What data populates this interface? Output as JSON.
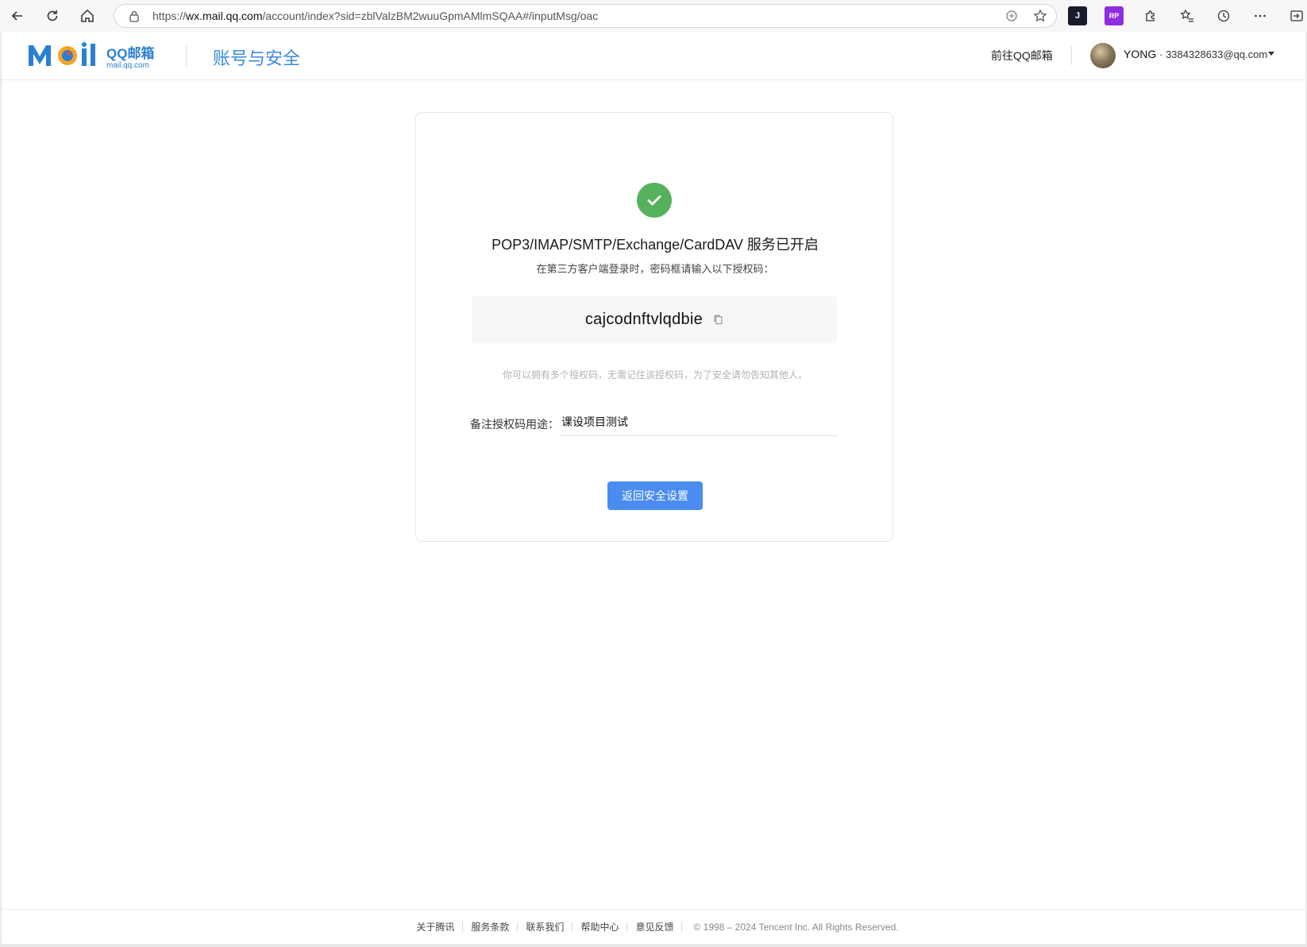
{
  "browser": {
    "url_prefix": "https://",
    "url_host": "wx.mail.qq.com",
    "url_path": "/account/index?sid=zblValzBM2wuuGpmAMlmSQAA#/inputMsg/oac",
    "extensions": [
      "J",
      "RP"
    ]
  },
  "header": {
    "logo_mark": "Mail",
    "logo_cn": "QQ邮箱",
    "logo_domain": "mail.qq.com",
    "title": "账号与安全",
    "goto_mail": "前往QQ邮箱",
    "user_name": "YONG",
    "user_email": "· 3384328633@qq.com"
  },
  "card": {
    "title": "POP3/IMAP/SMTP/Exchange/CardDAV 服务已开启",
    "subtitle": "在第三方客户端登录时，密码框请输入以下授权码：",
    "auth_code": "cajcodnftvlqdbie",
    "hint": "你可以拥有多个授权码，无需记住该授权码，为了安全请勿告知其他人。",
    "remark_label": "备注授权码用途：",
    "remark_value": "课设项目测试",
    "back_button": "返回安全设置"
  },
  "footer": {
    "links": [
      "关于腾讯",
      "服务条款",
      "联系我们",
      "帮助中心",
      "意见反馈"
    ],
    "copyright": "© 1998 – 2024 Tencent Inc. All Rights Reserved."
  },
  "colors": {
    "accent": "#4a8cf0",
    "success": "#56b15d",
    "brand_blue": "#2a7fd4",
    "brand_orange": "#f5a623"
  }
}
